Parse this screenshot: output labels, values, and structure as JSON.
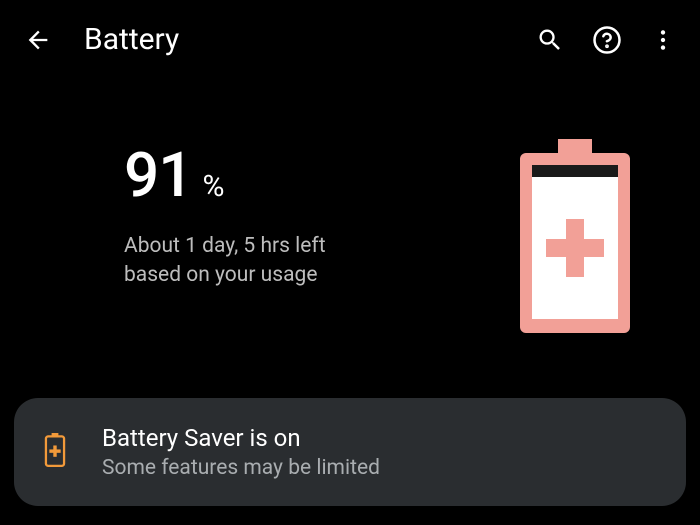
{
  "header": {
    "title": "Battery"
  },
  "battery": {
    "percent_value": "91",
    "percent_symbol": "%",
    "estimate_line1": "About 1 day, 5 hrs left",
    "estimate_line2": "based on your usage"
  },
  "saver": {
    "title": "Battery Saver is on",
    "subtitle": "Some features may be limited"
  },
  "colors": {
    "accent_salmon": "#f2a097",
    "accent_orange": "#f29a3a"
  }
}
